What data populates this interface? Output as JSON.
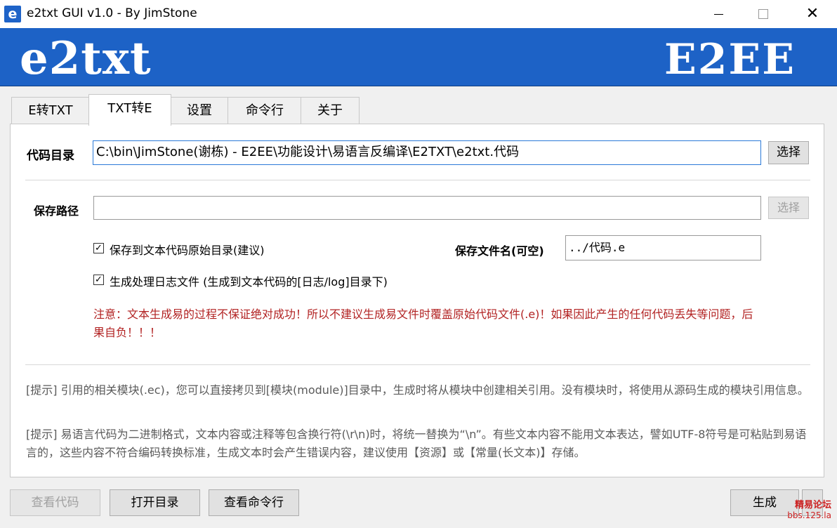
{
  "window": {
    "title": "e2txt GUI v1.0 - By JimStone",
    "icon_glyph": "e",
    "close_glyph": "✕"
  },
  "banner": {
    "logo_left": "e2txt",
    "logo_right": "E2EE"
  },
  "tabs": [
    {
      "label": "E转TXT"
    },
    {
      "label": "TXT转E"
    },
    {
      "label": "设置"
    },
    {
      "label": "命令行"
    },
    {
      "label": "关于"
    }
  ],
  "code_dir": {
    "label": "代码目录",
    "value": "C:\\bin\\JimStone(谢栋) - E2EE\\功能设计\\易语言反编译\\E2TXT\\e2txt.代码",
    "button": "选择"
  },
  "save_path": {
    "label": "保存路径",
    "value": "",
    "button": "选择"
  },
  "options": {
    "save_to_original": {
      "label": "保存到文本代码原始目录(建议)",
      "checked": "✓"
    },
    "gen_log": {
      "label": "生成处理日志文件 (生成到文本代码的[日志/log]目录下)",
      "checked": "✓"
    },
    "save_filename_label": "保存文件名(可空)",
    "save_filename_value": "../代码.e"
  },
  "warning": "注意：文本生成易的过程不保证绝对成功！所以不建议生成易文件时覆盖原始代码文件(.e)！如果因此产生的任何代码丢失等问题，后果自负！！！",
  "hints": [
    "[提示] 引用的相关模块(.ec)，您可以直接拷贝到[模块(module)]目录中，生成时将从模块中创建相关引用。没有模块时，将使用从源码生成的模块引用信息。",
    "[提示] 易语言代码为二进制格式，文本内容或注释等包含换行符(\\r\\n)时，将统一替换为“\\n”。有些文本内容不能用文本表达，譬如UTF-8符号是可粘贴到易语言的，这些内容不符合编码转换标准，生成文本时会产生错误内容，建议使用【资源】或【常量(长文本)】存储。"
  ],
  "bottom_buttons": {
    "view_code": "查看代码",
    "open_dir": "打开目录",
    "view_cmd": "查看命令行",
    "generate": "生成"
  },
  "watermark": {
    "line1": "精易论坛",
    "line2": "bbs.125.la"
  }
}
